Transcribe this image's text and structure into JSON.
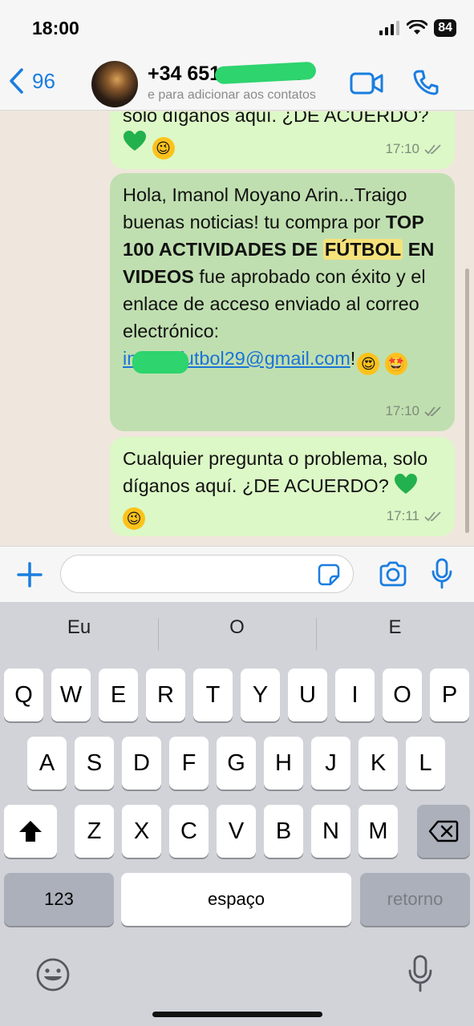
{
  "status_bar": {
    "time": "18:00",
    "battery": "84"
  },
  "header": {
    "back_count": "96",
    "contact_name": "+34 651 79 66 65",
    "contact_subtitle": "e para adicionar aos contatos"
  },
  "messages": [
    {
      "text": "solo díganos aquí. ¿DE ACUERDO?",
      "time": "17:10"
    },
    {
      "prefix": "Hola, Imanol Moyano Arin...Traigo buenas noticias! tu compra por ",
      "bold_1": "TOP 100 ACTIVIDADES DE ",
      "highlight": "FÚTBOL",
      "bold_2": " EN VIDEOS",
      "middle": " fue aprobado con éxito y el enlace de acceso enviado al correo electrónico: ",
      "email": "imanolfutbol29@gmail.com",
      "suffix": "!",
      "time": "17:10"
    },
    {
      "text": "Cualquier pregunta o problema, solo díganos aquí. ¿DE ACUERDO?",
      "time": "17:11"
    }
  ],
  "keyboard": {
    "suggestions": [
      "Eu",
      "O",
      "E"
    ],
    "row1": [
      "Q",
      "W",
      "E",
      "R",
      "T",
      "Y",
      "U",
      "I",
      "O",
      "P"
    ],
    "row2": [
      "A",
      "S",
      "D",
      "F",
      "G",
      "H",
      "J",
      "K",
      "L"
    ],
    "row3": [
      "Z",
      "X",
      "C",
      "V",
      "B",
      "N",
      "M"
    ],
    "numbers_label": "123",
    "space_label": "espaço",
    "return_label": "retorno"
  },
  "colors": {
    "accent": "#1a7de0",
    "bubble_light": "#dcf8c6",
    "bubble_highlighted": "#c0dfb0",
    "highlight": "#f6e27a",
    "redaction": "#2ed46e"
  },
  "icons": [
    "signal-icon",
    "wifi-icon",
    "battery-icon",
    "back-chevron-icon",
    "video-call-icon",
    "phone-icon",
    "plus-icon",
    "sticker-icon",
    "camera-icon",
    "microphone-icon",
    "shift-icon",
    "backspace-icon",
    "emoji-icon",
    "dictation-icon",
    "read-receipt-icon",
    "green-heart-icon",
    "winking-face-icon",
    "heart-eyes-icon",
    "star-struck-icon"
  ]
}
